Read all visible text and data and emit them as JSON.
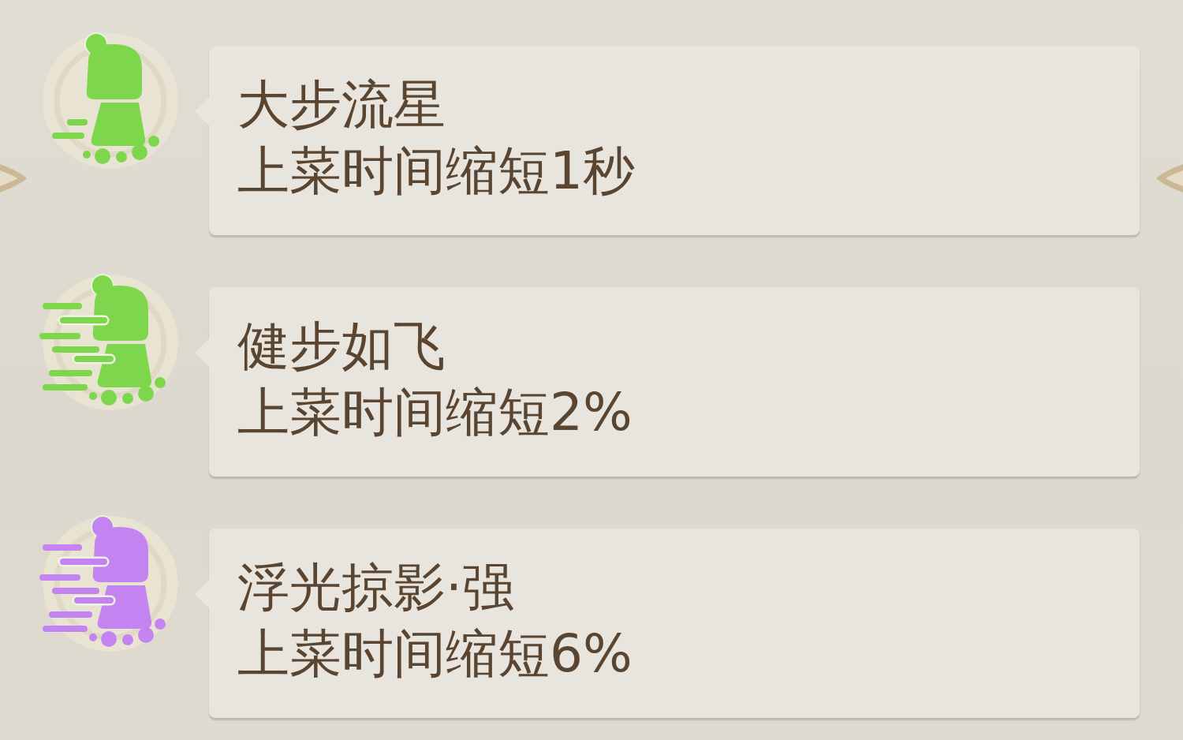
{
  "buffs": [
    {
      "kind": "walk",
      "color": "#7ed64c",
      "title": "大步流星",
      "description": "上菜时间缩短1秒"
    },
    {
      "kind": "dash",
      "color": "#7ed64c",
      "title": "健步如飞",
      "description": "上菜时间缩短2%"
    },
    {
      "kind": "dash",
      "color": "#c384f2",
      "title": "浮光掠影·强",
      "description": "上菜时间缩短6%"
    }
  ]
}
